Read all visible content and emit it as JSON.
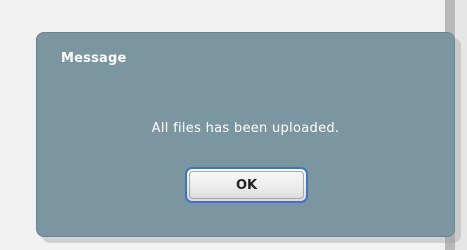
{
  "dialog": {
    "title": "Message",
    "message": "All files has been uploaded.",
    "ok_label": "OK"
  },
  "colors": {
    "dialog_bg": "#7c96a1",
    "button_border": "#3d74c9",
    "text": "#ffffff"
  }
}
